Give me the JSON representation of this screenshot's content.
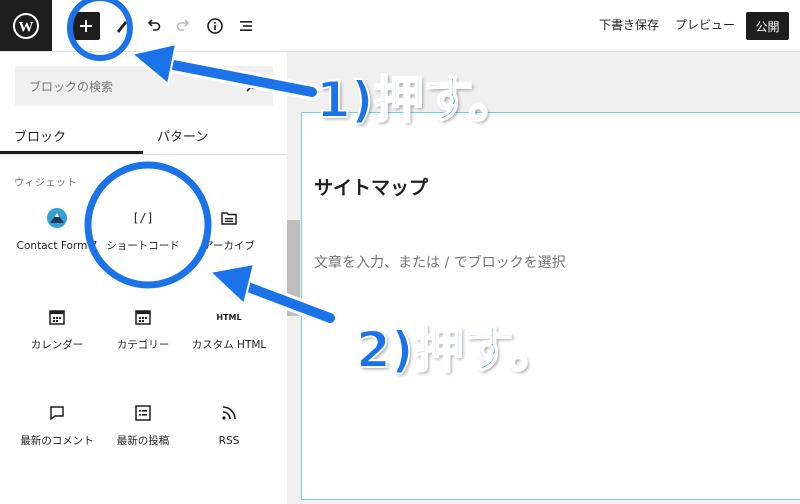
{
  "toolbar": {
    "save_draft": "下書き保存",
    "preview": "プレビュー",
    "publish": "公開"
  },
  "inserter": {
    "search_placeholder": "ブロックの検索",
    "tabs": [
      "ブロック",
      "パターン"
    ],
    "category": "ウィジェット",
    "blocks": [
      {
        "label": "Contact Form 7",
        "icon": "contact-form-icon"
      },
      {
        "label": "ショートコード",
        "icon": "shortcode-icon",
        "glyph": "[/]"
      },
      {
        "label": "アーカイブ",
        "icon": "archive-icon"
      },
      {
        "label": "カレンダー",
        "icon": "calendar-icon"
      },
      {
        "label": "カテゴリー",
        "icon": "category-icon"
      },
      {
        "label": "カスタム HTML",
        "icon": "html-icon",
        "glyph": "HTML"
      },
      {
        "label": "最新のコメント",
        "icon": "comment-icon"
      },
      {
        "label": "最新の投稿",
        "icon": "posts-list-icon"
      },
      {
        "label": "RSS",
        "icon": "rss-icon"
      }
    ]
  },
  "editor": {
    "title": "サイトマップ",
    "placeholder": "文章を入力、または / でブロックを選択"
  },
  "annotations": {
    "step1": "1)押す。",
    "step2": "2)押す。",
    "color": "#1a73e8"
  },
  "colors": {
    "dark": "#1e1e1e",
    "canvas_border": "#6cd5e0",
    "annotation_blue": "#1a73e8"
  }
}
